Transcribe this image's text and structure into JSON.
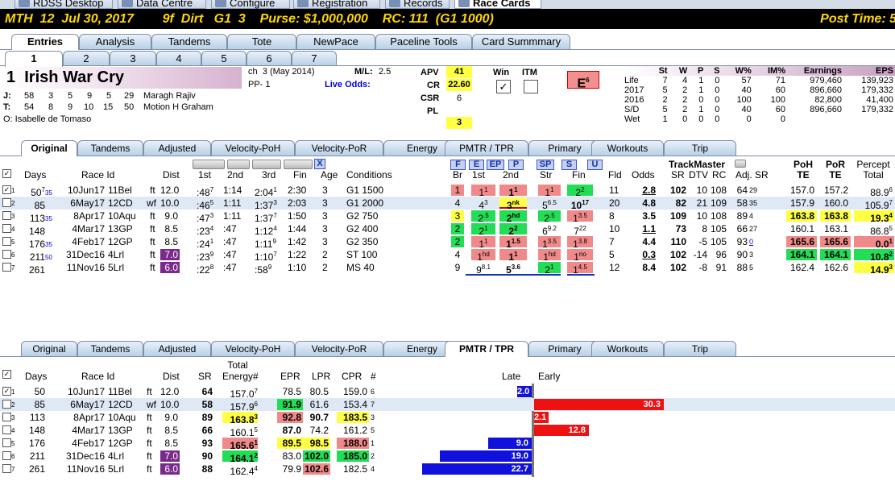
{
  "top_tabs": [
    "RDSS Desktop",
    "Data Centre",
    "Configure",
    "Registration",
    "Records",
    "Race Cards"
  ],
  "header": {
    "track": "MTH",
    "race": "12",
    "date": "Jul 30, 2017",
    "dist": "9f",
    "surface": "Dirt",
    "grade": "G1",
    "race_no": "3",
    "purse": "Purse: $1,000,000",
    "rc": "RC: 111",
    "g": "(G1 1000)",
    "post_time": "Post Time: 5"
  },
  "main_tabs": [
    "Entries",
    "Analysis",
    "Tandems",
    "Tote",
    "NewPace",
    "Paceline Tools",
    "Card Summmary"
  ],
  "horse_tabs": [
    "1",
    "2",
    "3",
    "4",
    "5",
    "6",
    "7"
  ],
  "horse": {
    "number": "1",
    "name": "Irish War Cry",
    "sex": "ch",
    "age": "3",
    "foaled": "(May 2014)",
    "pp": "PP- 1",
    "ml_label": "M/L:",
    "ml": "2.5",
    "live_odds": "Live Odds:",
    "j_label": "J:",
    "j_stats": [
      "58",
      "3",
      "5",
      "9",
      "5",
      "29"
    ],
    "jockey": "Maragh Rajiv",
    "t_label": "T:",
    "t_stats": [
      "54",
      "8",
      "9",
      "10",
      "15",
      "50"
    ],
    "trainer": "Motion H Graham",
    "owner": "O: Isabelle de Tomaso"
  },
  "ratings": {
    "apv_label": "APV",
    "apv": "41",
    "cr_label": "CR",
    "cr": "22.60",
    "csr_label": "CSR",
    "csr": "6",
    "pl_label": "PL",
    "pl": "",
    "extra": "3",
    "win": "Win",
    "itm": "ITM",
    "win_check": "✓",
    "e": "E",
    "e_sup": "6"
  },
  "stats": {
    "headers": [
      "St",
      "W",
      "P",
      "S",
      "W%",
      "IM%",
      "Earnings",
      "EPS"
    ],
    "rows": [
      [
        "Life",
        "7",
        "4",
        "1",
        "0",
        "57",
        "71",
        "979,460",
        "139,923"
      ],
      [
        "2017",
        "5",
        "2",
        "1",
        "0",
        "40",
        "60",
        "896,660",
        "179,332"
      ],
      [
        "2016",
        "2",
        "2",
        "0",
        "0",
        "100",
        "100",
        "82,800",
        "41,400"
      ],
      [
        "S/D",
        "5",
        "2",
        "1",
        "0",
        "40",
        "60",
        "896,660",
        "179,332"
      ],
      [
        "Wet",
        "1",
        "0",
        "0",
        "0",
        "0",
        "0",
        "",
        ""
      ]
    ]
  },
  "sub_tabs": [
    "Original",
    "Tandems",
    "Adjusted",
    "Velocity-PoH",
    "Velocity-PoR",
    "Energy",
    "PMTR / TPR",
    "Primary",
    "Workouts",
    "Trip"
  ],
  "t1": {
    "headers": [
      "Days",
      "Race Id",
      "Dist",
      "1st",
      "2nd",
      "3rd",
      "Fin",
      "Age",
      "Conditions",
      "Br",
      "1st",
      "2nd",
      "Str",
      "Fin",
      "Fld",
      "Odds",
      "SR",
      "DTV",
      "RC",
      "Adj. SR",
      "PoH TE",
      "PoR TE",
      "Percept Total"
    ],
    "tm": "TrackMaster",
    "x": "X",
    "btns": [
      "F",
      "E",
      "EP",
      "P",
      "SP",
      "S",
      "U"
    ],
    "rows": [
      {
        "n": "1",
        "days": "50",
        "ds": "7",
        "dd": "35",
        "date": "10Jun17",
        "race": "11Bel",
        "wf": "",
        "surf": "ft",
        "dist": "12.0",
        "c1": ":48",
        "c1s": "7",
        "c2": "1:14",
        "c3": "2:04",
        "c3s": "1",
        "fin": "2:30",
        "age": "3",
        "cond": "G1 1500",
        "br": "1",
        "p1": "1",
        "p1s": "1",
        "p2": "1",
        "p2s": "1",
        "str": "1",
        "strs": "1",
        "fn": "2",
        "fns": "2",
        "fld": "11",
        "odds": "2.8",
        "sr": "102",
        "dtv": "10",
        "rc": "108",
        "adj": "64",
        "adjs": "29",
        "poh": "157.0",
        "por": "157.2",
        "pct": "88.9",
        "pcts": "6"
      },
      {
        "n": "2",
        "days": "85",
        "ds": "",
        "dd": "",
        "date": "6May17",
        "race": "12CD",
        "wf": "wf",
        "surf": "",
        "dist": "10.0",
        "c1": ":46",
        "c1s": "5",
        "c2": "1:11",
        "c3": "1:37",
        "c3s": "3",
        "fin": "2:03",
        "age": "3",
        "cond": "G1 2000",
        "br": "4",
        "p1": "4",
        "p1s": "3",
        "p2": "3",
        "p2s": "nk",
        "str": "5",
        "strs": "6.5",
        "fn": "10",
        "fns": "17",
        "fld": "20",
        "odds": "4.8",
        "sr": "82",
        "dtv": "21",
        "rc": "109",
        "adj": "58",
        "adjs": "35",
        "poh": "157.9",
        "por": "160.0",
        "pct": "105.9",
        "pcts": "7"
      },
      {
        "n": "3",
        "days": "113",
        "ds": "",
        "dd": "35",
        "date": "8Apr17",
        "race": "10Aqu",
        "wf": "",
        "surf": "ft",
        "dist": "9.0",
        "c1": ":47",
        "c1s": "3",
        "c2": "1:11",
        "c3": "1:37",
        "c3s": "7",
        "fin": "1:50",
        "age": "3",
        "cond": "G2 750",
        "br": "3",
        "p1": "2",
        "p1s": ".5",
        "p2": "2",
        "p2s": "hd",
        "str": "2",
        "strs": ".5",
        "fn": "1",
        "fns": "3.5",
        "fld": "8",
        "odds": "3.5",
        "sr": "109",
        "dtv": "10",
        "rc": "108",
        "adj": "89",
        "adjs": "4",
        "poh": "163.8",
        "por": "163.8",
        "pct": "19.3",
        "pcts": "4"
      },
      {
        "n": "4",
        "days": "148",
        "ds": "",
        "dd": "",
        "date": "4Mar17",
        "race": "13GP",
        "wf": "",
        "surf": "ft",
        "dist": "8.5",
        "c1": ":23",
        "c1s": "4",
        "c2": ":47",
        "c3": "1:12",
        "c3s": "4",
        "fin": "1:44",
        "age": "3",
        "cond": "G2 400",
        "br": "2",
        "p1": "2",
        "p1s": "1",
        "p2": "2",
        "p2s": "2",
        "str": "6",
        "strs": "9.2",
        "fn": "7",
        "fns": "22",
        "fld": "10",
        "odds": "1.1",
        "sr": "73",
        "dtv": "8",
        "rc": "105",
        "adj": "66",
        "adjs": "27",
        "poh": "160.1",
        "por": "163.1",
        "pct": "86.8",
        "pcts": "5"
      },
      {
        "n": "5",
        "days": "176",
        "ds": "",
        "dd": "35",
        "date": "4Feb17",
        "race": "12GP",
        "wf": "",
        "surf": "ft",
        "dist": "8.5",
        "c1": ":24",
        "c1s": "1",
        "c2": ":47",
        "c3": "1:11",
        "c3s": "9",
        "fin": "1:42",
        "age": "3",
        "cond": "G2 350",
        "br": "2",
        "p1": "1",
        "p1s": "1",
        "p2": "1",
        "p2s": "1.5",
        "str": "1",
        "strs": "3.5",
        "fn": "1",
        "fns": "3.8",
        "fld": "7",
        "odds": "4.4",
        "sr": "110",
        "dtv": "-5",
        "rc": "105",
        "adj": "93",
        "adjs": "0",
        "poh": "165.6",
        "por": "165.6",
        "pct": "0.0",
        "pcts": "1"
      },
      {
        "n": "6",
        "days": "211",
        "ds": "",
        "dd": "50",
        "date": "31Dec16",
        "race": "4Lrl",
        "wf": "",
        "surf": "ft",
        "dist": "7.0",
        "c1": ":23",
        "c1s": "9",
        "c2": ":47",
        "c3": "1:10",
        "c3s": "7",
        "fin": "1:22",
        "age": "2",
        "cond": "ST 100",
        "br": "4",
        "p1": "1",
        "p1s": "hd",
        "p2": "1",
        "p2s": "1",
        "str": "1",
        "strs": "hd",
        "fn": "1",
        "fns": "no",
        "fld": "5",
        "odds": "0.3",
        "sr": "102",
        "dtv": "-14",
        "rc": "96",
        "adj": "90",
        "adjs": "3",
        "poh": "164.1",
        "por": "164.1",
        "pct": "10.8",
        "pcts": "2"
      },
      {
        "n": "7",
        "days": "261",
        "ds": "",
        "dd": "",
        "date": "11Nov16",
        "race": "5Lrl",
        "wf": "",
        "surf": "ft",
        "dist": "6.0",
        "c1": ":22",
        "c1s": "8",
        "c2": ":47",
        "c3": ":58",
        "c3s": "9",
        "fin": "1:10",
        "age": "2",
        "cond": "MS 40",
        "br": "9",
        "p1": "9",
        "p1s": "8.1",
        "p2": "5",
        "p2s": "3.6",
        "str": "2",
        "strs": "1",
        "fn": "1",
        "fns": "4.5",
        "fld": "12",
        "odds": "8.4",
        "sr": "102",
        "dtv": "-8",
        "rc": "91",
        "adj": "88",
        "adjs": "5",
        "poh": "162.4",
        "por": "162.6",
        "pct": "14.9",
        "pcts": "3"
      }
    ]
  },
  "t2": {
    "headers": [
      "Days",
      "Race Id",
      "Dist",
      "SR",
      "Total Energy",
      "#",
      "EPR",
      "LPR",
      "CPR",
      "#",
      "Late",
      "Early"
    ],
    "rows": [
      {
        "n": "1",
        "days": "50",
        "date": "10Jun17",
        "race": "11Bel",
        "surf": "ft",
        "dist": "12.0",
        "sr": "64",
        "te": "157.0",
        "tes": "7",
        "epr": "78.5",
        "lpr": "80.5",
        "cpr": "159.0",
        "cprs": "6",
        "late": "2.0",
        "early": ""
      },
      {
        "n": "2",
        "days": "85",
        "date": "6May17",
        "race": "12CD",
        "surf": "wf",
        "dist": "10.0",
        "sr": "58",
        "te": "157.9",
        "tes": "6",
        "epr": "91.9",
        "lpr": "61.6",
        "cpr": "153.4",
        "cprs": "7",
        "late": "",
        "early": "30.3"
      },
      {
        "n": "3",
        "days": "113",
        "date": "8Apr17",
        "race": "10Aqu",
        "surf": "ft",
        "dist": "9.0",
        "sr": "89",
        "te": "163.8",
        "tes": "3",
        "epr": "92.8",
        "lpr": "90.7",
        "cpr": "183.5",
        "cprs": "3",
        "late": "",
        "early": "2.1"
      },
      {
        "n": "4",
        "days": "148",
        "date": "4Mar17",
        "race": "13GP",
        "surf": "ft",
        "dist": "8.5",
        "sr": "66",
        "te": "160.1",
        "tes": "5",
        "epr": "87.0",
        "lpr": "74.2",
        "cpr": "161.2",
        "cprs": "5",
        "late": "",
        "early": "12.8"
      },
      {
        "n": "5",
        "days": "176",
        "date": "4Feb17",
        "race": "12GP",
        "surf": "ft",
        "dist": "8.5",
        "sr": "93",
        "te": "165.6",
        "tes": "1",
        "epr": "89.5",
        "lpr": "98.5",
        "cpr": "188.0",
        "cprs": "1",
        "late": "9.0",
        "early": ""
      },
      {
        "n": "6",
        "days": "211",
        "date": "31Dec16",
        "race": "4Lrl",
        "surf": "ft",
        "dist": "7.0",
        "sr": "90",
        "te": "164.1",
        "tes": "2",
        "epr": "83.0",
        "lpr": "102.0",
        "cpr": "185.0",
        "cprs": "2",
        "late": "19.0",
        "early": ""
      },
      {
        "n": "7",
        "days": "261",
        "date": "11Nov16",
        "race": "5Lrl",
        "surf": "ft",
        "dist": "6.0",
        "sr": "88",
        "te": "162.4",
        "tes": "4",
        "epr": "79.9",
        "lpr": "102.6",
        "cpr": "182.5",
        "cprs": "4",
        "late": "22.7",
        "early": ""
      }
    ]
  },
  "colors": {
    "header_bg": "#000000",
    "header_text": "#ffd700",
    "late_bar": "#1111dd",
    "early_bar": "#ee1111",
    "yellow": "#ffff44",
    "pink": "#f08a8a",
    "green": "#22dd55",
    "purple": "#7a2a8a"
  }
}
